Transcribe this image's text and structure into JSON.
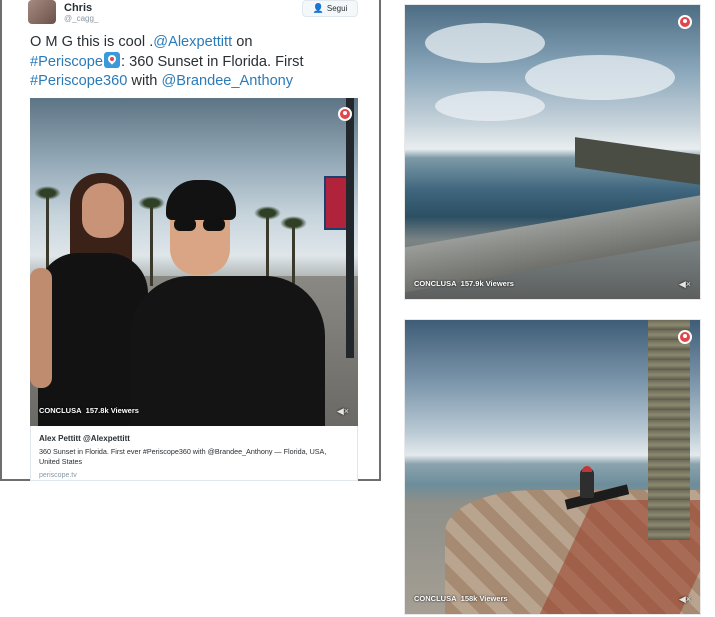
{
  "tweet": {
    "user_name": "Chris",
    "user_handle": "@_cagg_",
    "follow_label": "Segui",
    "text_parts": {
      "p1": "O M G this is cool .",
      "mention1": "@Alexpettitt",
      "p2": " on ",
      "hashtag1": "#Periscope",
      "p3": ": 360 Sunset in Florida. First ",
      "hashtag2": "#Periscope360",
      "p4": " with ",
      "mention2": "@Brandee_Anthony"
    },
    "video": {
      "status": "CONCLUSA",
      "viewers": "157.8k Viewers"
    },
    "card": {
      "title": "Alex Pettitt @Alexpettitt",
      "description": "360 Sunset in Florida. First ever #Periscope360 with @Brandee_Anthony — Florida, USA, United States",
      "domain": "periscope.tv"
    }
  },
  "screenshots": [
    {
      "status": "CONCLUSA",
      "viewers": "157.9k Viewers"
    },
    {
      "status": "CONCLUSA",
      "viewers": "158k Viewers"
    }
  ],
  "icons": {
    "follow": "add-user-icon",
    "periscope": "periscope-icon",
    "mute": "mute-icon"
  },
  "colors": {
    "link": "#2b7bb9",
    "periscope_red": "#e0464c",
    "periscope_blue": "#3a9ad9"
  }
}
